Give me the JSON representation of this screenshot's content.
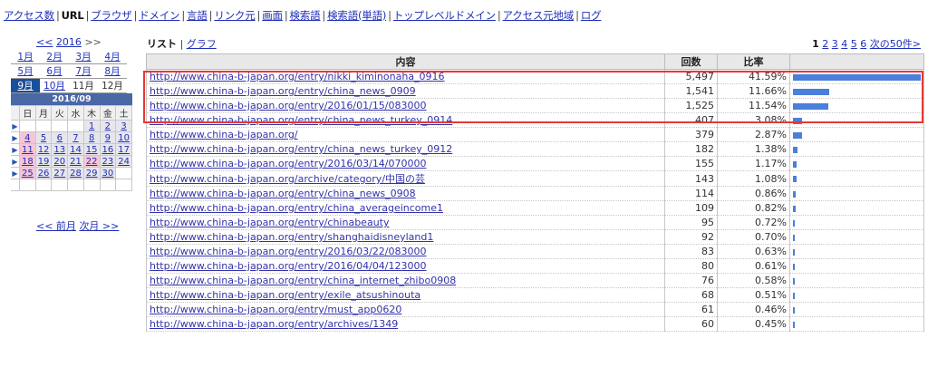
{
  "topnav": [
    {
      "label": "アクセス数",
      "active": false
    },
    {
      "label": "URL",
      "active": true
    },
    {
      "label": "ブラウザ",
      "active": false
    },
    {
      "label": "ドメイン",
      "active": false
    },
    {
      "label": "言語",
      "active": false
    },
    {
      "label": "リンク元",
      "active": false
    },
    {
      "label": "画面",
      "active": false
    },
    {
      "label": "検索語",
      "active": false
    },
    {
      "label": "検索語(単語)",
      "active": false
    },
    {
      "label": "トップレベルドメイン",
      "active": false
    },
    {
      "label": "アクセス元地域",
      "active": false
    },
    {
      "label": "ログ",
      "active": false
    }
  ],
  "sidebar": {
    "prev_year": "<<",
    "year": "2016",
    "next_year": ">>",
    "months": [
      [
        {
          "label": "1月",
          "link": true
        },
        {
          "label": "2月",
          "link": true
        },
        {
          "label": "3月",
          "link": true
        },
        {
          "label": "4月",
          "link": true
        }
      ],
      [
        {
          "label": "5月",
          "link": true
        },
        {
          "label": "6月",
          "link": true
        },
        {
          "label": "7月",
          "link": true
        },
        {
          "label": "8月",
          "link": true
        }
      ],
      [
        {
          "label": "9月",
          "link": true,
          "selected": true
        },
        {
          "label": "10月",
          "link": true
        },
        {
          "label": "11月",
          "link": false
        },
        {
          "label": "12月",
          "link": false
        }
      ]
    ],
    "calendar": {
      "title": "2016/09",
      "weekdays": [
        "日",
        "月",
        "火",
        "水",
        "木",
        "金",
        "土"
      ],
      "weeks": [
        [
          "",
          "",
          "",
          "",
          "1",
          "2",
          "3"
        ],
        [
          "4",
          "5",
          "6",
          "7",
          "8",
          "9",
          "10"
        ],
        [
          "11",
          "12",
          "13",
          "14",
          "15",
          "16",
          "17"
        ],
        [
          "18",
          "19",
          "20",
          "21",
          "22",
          "23",
          "24"
        ],
        [
          "25",
          "26",
          "27",
          "28",
          "29",
          "30",
          ""
        ],
        [
          "",
          "",
          "",
          "",
          "",
          "",
          ""
        ]
      ],
      "highlighted_days": [
        "4",
        "11",
        "18",
        "25",
        "22"
      ]
    },
    "prev_month": "<< 前月",
    "next_month": "次月 >>"
  },
  "main": {
    "list_label": "リスト",
    "graph_label": "グラフ",
    "pager": {
      "pages": [
        "1",
        "2",
        "3",
        "4",
        "5",
        "6"
      ],
      "current": "1",
      "next": "次の50件>"
    },
    "headers": {
      "content": "内容",
      "count": "回数",
      "ratio": "比率"
    },
    "rows": [
      {
        "url": "http://www.china-b-japan.org/entry/nikki_kiminonaha_0916",
        "count": "5,497",
        "ratio": "41.59%",
        "pct": 41.59
      },
      {
        "url": "http://www.china-b-japan.org/entry/china_news_0909",
        "count": "1,541",
        "ratio": "11.66%",
        "pct": 11.66
      },
      {
        "url": "http://www.china-b-japan.org/entry/2016/01/15/083000",
        "count": "1,525",
        "ratio": "11.54%",
        "pct": 11.54
      },
      {
        "url": "http://www.china-b-japan.org/entry/china_news_turkey_0914",
        "count": "407",
        "ratio": "3.08%",
        "pct": 3.08
      },
      {
        "url": "http://www.china-b-japan.org/",
        "count": "379",
        "ratio": "2.87%",
        "pct": 2.87
      },
      {
        "url": "http://www.china-b-japan.org/entry/china_news_turkey_0912",
        "count": "182",
        "ratio": "1.38%",
        "pct": 1.38
      },
      {
        "url": "http://www.china-b-japan.org/entry/2016/03/14/070000",
        "count": "155",
        "ratio": "1.17%",
        "pct": 1.17
      },
      {
        "url": "http://www.china-b-japan.org/archive/category/中国の芸",
        "count": "143",
        "ratio": "1.08%",
        "pct": 1.08
      },
      {
        "url": "http://www.china-b-japan.org/entry/china_news_0908",
        "count": "114",
        "ratio": "0.86%",
        "pct": 0.86
      },
      {
        "url": "http://www.china-b-japan.org/entry/china_averageincome1",
        "count": "109",
        "ratio": "0.82%",
        "pct": 0.82
      },
      {
        "url": "http://www.china-b-japan.org/entry/chinabeauty",
        "count": "95",
        "ratio": "0.72%",
        "pct": 0.72
      },
      {
        "url": "http://www.china-b-japan.org/entry/shanghaidisneyland1",
        "count": "92",
        "ratio": "0.70%",
        "pct": 0.7
      },
      {
        "url": "http://www.china-b-japan.org/entry/2016/03/22/083000",
        "count": "83",
        "ratio": "0.63%",
        "pct": 0.63
      },
      {
        "url": "http://www.china-b-japan.org/entry/2016/04/04/123000",
        "count": "80",
        "ratio": "0.61%",
        "pct": 0.61
      },
      {
        "url": "http://www.china-b-japan.org/entry/china_internet_zhibo0908",
        "count": "76",
        "ratio": "0.58%",
        "pct": 0.58
      },
      {
        "url": "http://www.china-b-japan.org/entry/exile_atsushinouta",
        "count": "68",
        "ratio": "0.51%",
        "pct": 0.51
      },
      {
        "url": "http://www.china-b-japan.org/entry/must_app0620",
        "count": "61",
        "ratio": "0.46%",
        "pct": 0.46
      },
      {
        "url": "http://www.china-b-japan.org/entry/archives/1349",
        "count": "60",
        "ratio": "0.45%",
        "pct": 0.45
      }
    ]
  },
  "colors": {
    "highlight": "#e53935",
    "bar": "#4a7fdc",
    "calendar_header": "#4a67a6",
    "selected_month": "#1a4f9a"
  }
}
